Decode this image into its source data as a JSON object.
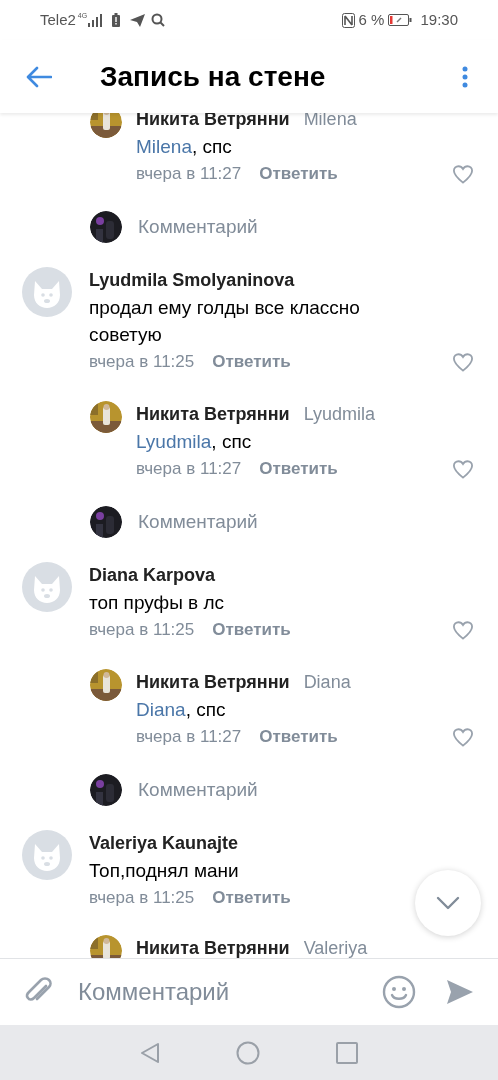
{
  "status_bar": {
    "carrier": "Tele2",
    "network": "4G",
    "nfc_battery": "6 %",
    "time": "19:30"
  },
  "header": {
    "title": "Запись на стене"
  },
  "items": [
    {
      "kind": "reply",
      "author": "Никита Ветрянни",
      "reply_to": "Milena",
      "mention": "Milena",
      "text": ", спс",
      "time": "вчера в 11:27",
      "action": "Ответить",
      "liked": false
    },
    {
      "kind": "prompt",
      "placeholder": "Комментарий"
    },
    {
      "kind": "comment",
      "author": "Lyudmila Smolyaninova",
      "text": "продал ему голды все классно советую",
      "time": "вчера в 11:25",
      "action": "Ответить",
      "liked": false
    },
    {
      "kind": "reply",
      "author": "Никита Ветрянни",
      "reply_to": "Lyudmila",
      "mention": "Lyudmila",
      "text": ", спс",
      "time": "вчера в 11:27",
      "action": "Ответить",
      "liked": false
    },
    {
      "kind": "prompt",
      "placeholder": "Комментарий"
    },
    {
      "kind": "comment",
      "author": "Diana Karpova",
      "text": "топ пруфы в лс",
      "time": "вчера в 11:25",
      "action": "Ответить",
      "liked": false
    },
    {
      "kind": "reply",
      "author": "Никита Ветрянни",
      "reply_to": "Diana",
      "mention": "Diana",
      "text": ", спс",
      "time": "вчера в 11:27",
      "action": "Ответить",
      "liked": false
    },
    {
      "kind": "prompt",
      "placeholder": "Комментарий"
    },
    {
      "kind": "comment",
      "author": "Valeriya Kaunajte",
      "text": "Топ,поднял мани",
      "time": "вчера в 11:25",
      "action": "Ответить"
    },
    {
      "kind": "reply",
      "author": "Никита Ветрянни",
      "reply_to": "Valeriya"
    }
  ],
  "composer": {
    "placeholder": "Комментарий"
  }
}
